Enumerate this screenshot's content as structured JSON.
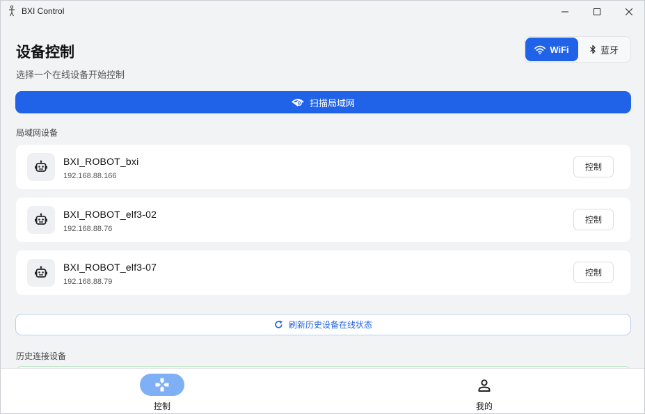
{
  "window": {
    "title": "BXI Control"
  },
  "header": {
    "title": "设备控制",
    "subtitle": "选择一个在线设备开始控制"
  },
  "mode_toggle": {
    "wifi_label": "WiFi",
    "bluetooth_label": "蓝牙",
    "selected": "WiFi"
  },
  "scan_button": {
    "label": "扫描局域网"
  },
  "lan_section": {
    "label": "局域网设备",
    "devices": [
      {
        "name": "BXI_ROBOT_bxi",
        "ip": "192.168.88.166",
        "action": "控制"
      },
      {
        "name": "BXI_ROBOT_elf3-02",
        "ip": "192.168.88.76",
        "action": "控制"
      },
      {
        "name": "BXI_ROBOT_elf3-07",
        "ip": "192.168.88.79",
        "action": "控制"
      }
    ]
  },
  "refresh_button": {
    "label": "刷新历史设备在线状态"
  },
  "history_section": {
    "label": "历史连接设备"
  },
  "bottom_nav": {
    "items": [
      {
        "label": "控制",
        "icon": "gamepad-icon",
        "active": true
      },
      {
        "label": "我的",
        "icon": "person-icon",
        "active": false
      }
    ]
  },
  "colors": {
    "accent": "#2163e8",
    "nav_active_pill": "#7fb0f5",
    "background": "#f2f3f5",
    "card": "#ffffff"
  }
}
